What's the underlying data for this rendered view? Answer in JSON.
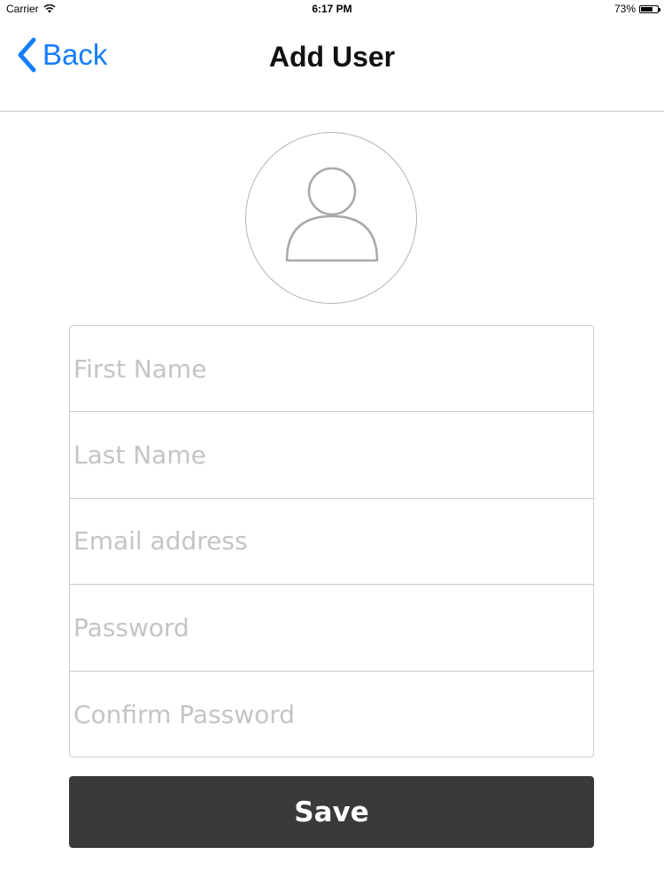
{
  "status_bar": {
    "carrier": "Carrier",
    "time": "6:17 PM",
    "battery": "73%",
    "battery_level": 0.73
  },
  "nav": {
    "back_label": "Back",
    "title": "Add User"
  },
  "avatar": {
    "icon": "user-silhouette-icon"
  },
  "form": {
    "first_name": {
      "placeholder": "First Name",
      "value": ""
    },
    "last_name": {
      "placeholder": "Last Name",
      "value": ""
    },
    "email": {
      "placeholder": "Email address",
      "value": ""
    },
    "password": {
      "placeholder": "Password",
      "value": ""
    },
    "confirm_password": {
      "placeholder": "Confirm Password",
      "value": ""
    }
  },
  "save_label": "Save",
  "colors": {
    "accent": "#147efb",
    "button": "#3a393b",
    "placeholder": "#c4c4c9"
  }
}
